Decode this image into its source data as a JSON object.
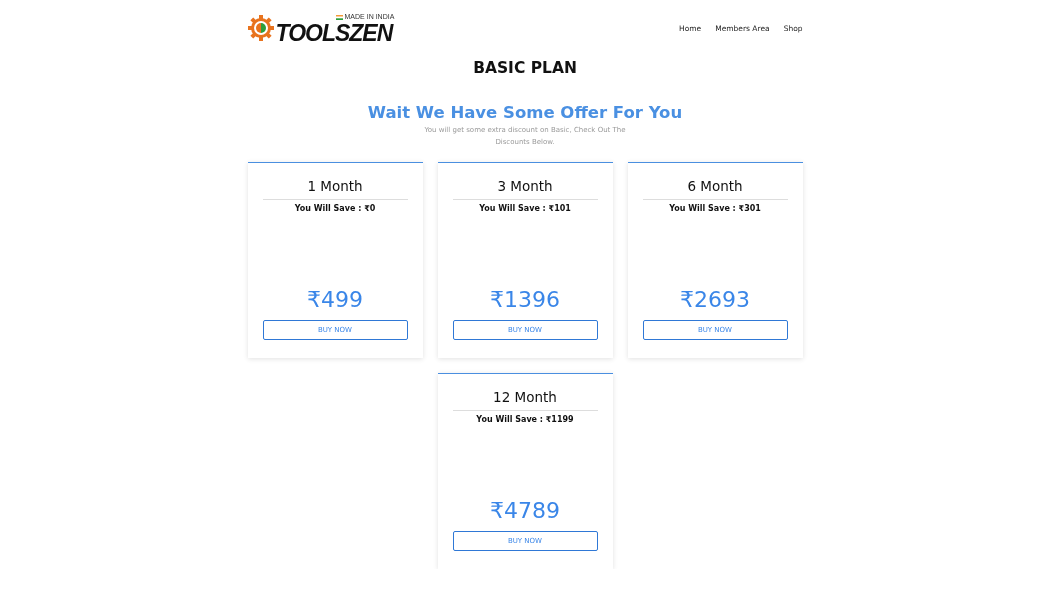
{
  "logo": {
    "text": "TOOLSZEN",
    "tagline": "MADE IN INDIA"
  },
  "nav": [
    "Home",
    "Members Area",
    "Shop"
  ],
  "title": "BASIC PLAN",
  "offer": {
    "heading": "Wait We Have Some Offer For You",
    "subtitle": "You will get some extra discount on Basic, Check Out The Discounts Below."
  },
  "plans": [
    {
      "duration": "1 Month",
      "savings": "You Will Save : ₹0",
      "price": "₹499",
      "button": "BUY NOW"
    },
    {
      "duration": "3 Month",
      "savings": "You Will Save : ₹101",
      "price": "₹1396",
      "button": "BUY NOW"
    },
    {
      "duration": "6 Month",
      "savings": "You Will Save : ₹301",
      "price": "₹2693",
      "button": "BUY NOW"
    },
    {
      "duration": "12 Month",
      "savings": "You Will Save : ₹1199",
      "price": "₹4789",
      "button": "BUY NOW"
    }
  ]
}
